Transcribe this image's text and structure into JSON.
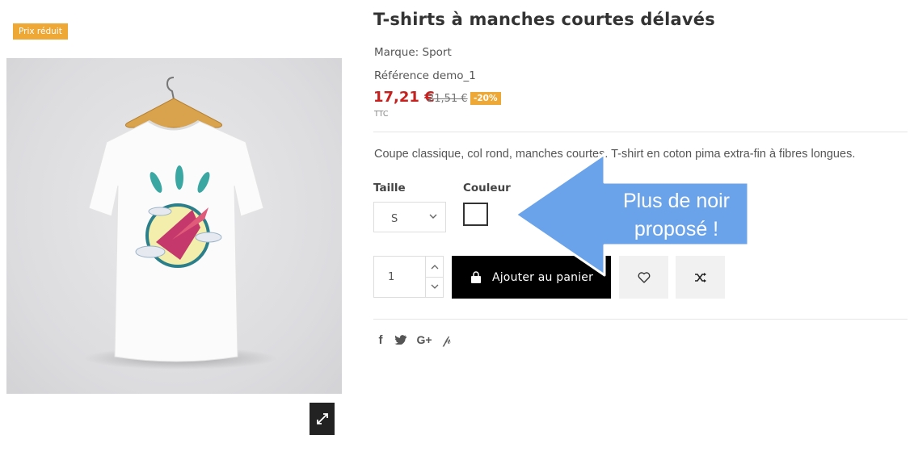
{
  "product": {
    "badge": "Prix réduit",
    "title": "T-shirts à manches courtes délavés",
    "brand": "Marque: Sport",
    "reference": "Référence demo_1",
    "price": "17,21 €",
    "old_price": "21,51 €",
    "discount": "-20%",
    "tax_label": "TTC",
    "description": "Coupe classique, col rond, manches courtes. T-shirt en coton pima extra-fin à fibres longues."
  },
  "options": {
    "size_label": "Taille",
    "size_value": "S",
    "color_label": "Couleur",
    "swatch_color": "#ffffff"
  },
  "cart": {
    "quantity": "1",
    "add_label": "Ajouter au panier"
  },
  "icons": {
    "expand": "expand-icon",
    "bag": "shopping-bag-icon",
    "wishlist": "heart-icon",
    "compare": "shuffle-icon",
    "share": [
      "facebook-icon",
      "twitter-icon",
      "google-plus-icon",
      "pinterest-icon"
    ]
  },
  "annotation": {
    "line1": "Plus de noir",
    "line2": "proposé !",
    "color": "#6aa3ea"
  },
  "colors": {
    "price": "#c6211f",
    "badge": "#eda835",
    "button": "#000000"
  }
}
